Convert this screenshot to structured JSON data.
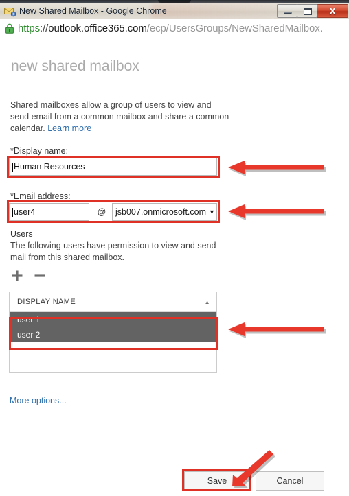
{
  "window": {
    "title": "New Shared Mailbox - Google Chrome",
    "app_icon": "mail-settings-icon",
    "minimize_label": "─",
    "maximize_label": "□",
    "close_label": "X"
  },
  "address_bar": {
    "lock_icon": "padlock-secure-icon",
    "scheme": "https",
    "separator": "://",
    "host": "outlook.office365.com",
    "path": "/ecp/UsersGroups/NewSharedMailbox."
  },
  "page": {
    "title": "new shared mailbox",
    "intro_text": "Shared mailboxes allow a group of users to view and send email from a common mailbox and share a common calendar. ",
    "intro_link": "Learn more",
    "display_name": {
      "label": "*Display name:",
      "value": "Human Resources",
      "placeholder": ""
    },
    "email_address": {
      "label": "*Email address:",
      "alias_value": "user4",
      "alias_placeholder": "",
      "at_symbol": "@",
      "domain_value": "jsb007.onmicrosoft.com",
      "domain_arrow": "▼",
      "domain_options": [
        "jsb007.onmicrosoft.com"
      ]
    },
    "users": {
      "heading": "Users",
      "description": "The following users have permission to view and send mail from this shared mailbox.",
      "add_icon": "plus-icon",
      "remove_icon": "minus-icon",
      "add_label": "+",
      "remove_label": "─",
      "column_header": "DISPLAY NAME",
      "sort_indicator": "▲",
      "rows": [
        {
          "name": "user 1",
          "selected": true
        },
        {
          "name": "user 2",
          "selected": true
        }
      ]
    },
    "more_options": "More options...",
    "buttons": {
      "save": "Save",
      "cancel": "Cancel"
    }
  },
  "annotations": {
    "accent_color": "#e03127",
    "highlight_display_name": "red-box-display-name",
    "highlight_email": "red-box-email",
    "highlight_users": "red-box-user-rows",
    "highlight_save": "red-box-save",
    "arrow_display_name": "red-arrow-left",
    "arrow_email": "red-arrow-left",
    "arrow_users": "red-arrow-left",
    "arrow_save": "red-arrow-diagonal"
  }
}
